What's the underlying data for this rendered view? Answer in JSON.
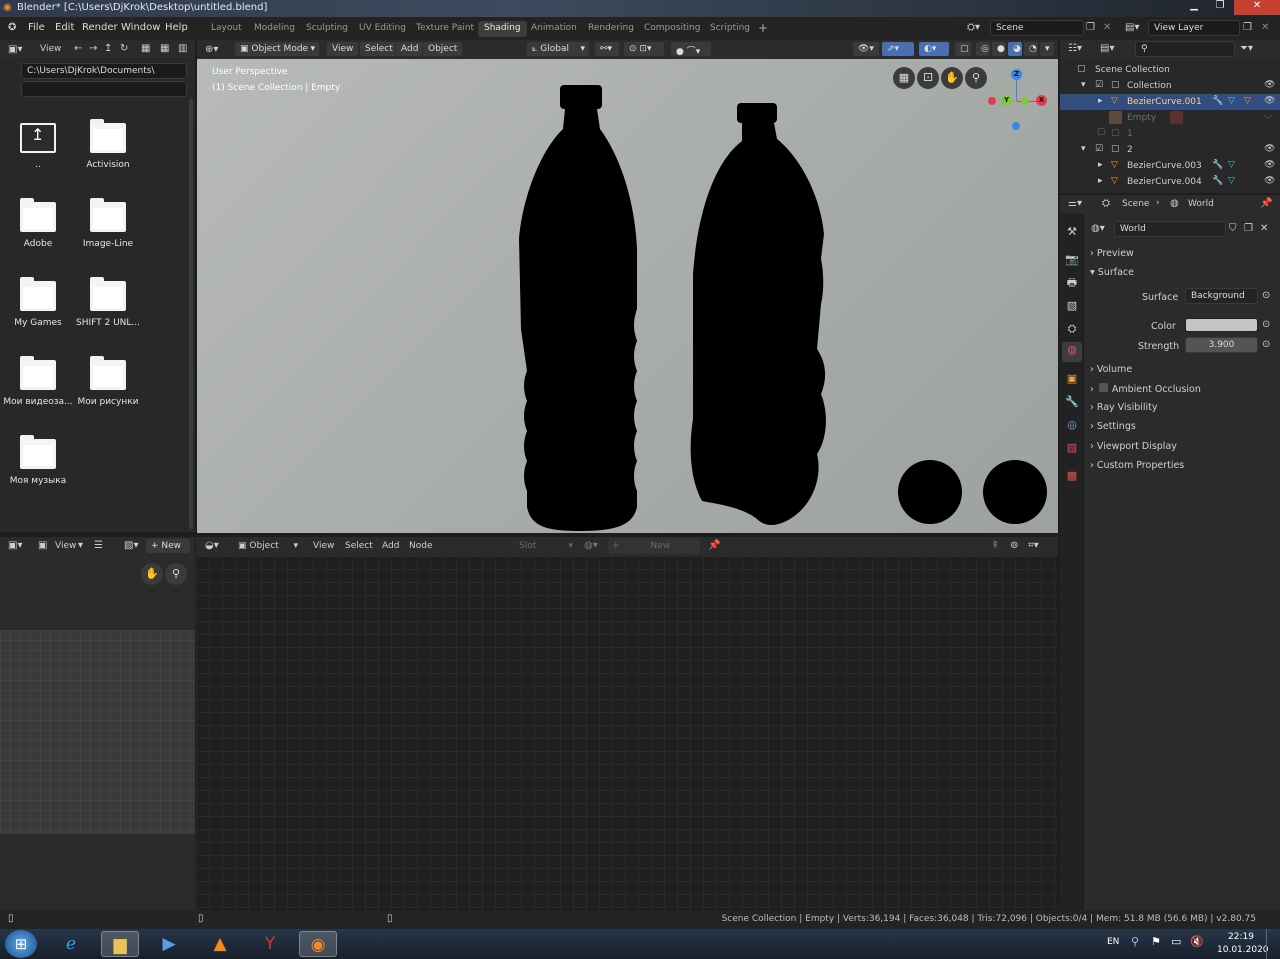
{
  "window": {
    "title": "Blender* [C:\\Users\\DjKrok\\Desktop\\untitled.blend]"
  },
  "menu": {
    "items": [
      "File",
      "Edit",
      "Render",
      "Window",
      "Help"
    ]
  },
  "workspaces": {
    "tabs": [
      "Layout",
      "Modeling",
      "Sculpting",
      "UV Editing",
      "Texture Paint",
      "Shading",
      "Animation",
      "Rendering",
      "Compositing",
      "Scripting"
    ],
    "active": "Shading",
    "add": "+"
  },
  "scene": {
    "name": "Scene",
    "view_layer": "View Layer"
  },
  "file_browser": {
    "view_label": "View",
    "path": "C:\\Users\\DjKrok\\Documents\\",
    "items": [
      "..",
      "Activision",
      "Adobe",
      "Image-Line",
      "My Games",
      "SHIFT 2 UNL...",
      "Мои видеоза...",
      "Мои рисунки",
      "Моя музыка"
    ]
  },
  "viewport": {
    "mode": "Object Mode",
    "menus": [
      "View",
      "Select",
      "Add",
      "Object"
    ],
    "transform": "Global",
    "perspective": "User Perspective",
    "context": "(1) Scene Collection | Empty",
    "gizmo": {
      "z": "Z",
      "y": "Y",
      "x": "X"
    }
  },
  "image_editor": {
    "view_label": "View",
    "new_label": "New"
  },
  "node_editor": {
    "type": "Object",
    "menus": [
      "View",
      "Select",
      "Add",
      "Node"
    ],
    "slot": "Slot",
    "new_label": "New"
  },
  "outliner": {
    "root": "Scene Collection",
    "rows": [
      {
        "name": "Collection"
      },
      {
        "name": "BezierCurve.001"
      },
      {
        "name": "Empty"
      },
      {
        "name": "1"
      },
      {
        "name": "2"
      },
      {
        "name": "BezierCurve.003"
      },
      {
        "name": "BezierCurve.004"
      }
    ]
  },
  "properties": {
    "tabs": [
      "Scene",
      "World"
    ],
    "world_name": "World",
    "panels": {
      "preview": "Preview",
      "surface": "Surface",
      "volume": "Volume",
      "ambient_occlusion": "Ambient Occlusion",
      "ray_visibility": "Ray Visibility",
      "settings": "Settings",
      "viewport_display": "Viewport Display",
      "custom_properties": "Custom Properties"
    },
    "surface_label": "Surface",
    "surface_value": "Background",
    "color_label": "Color",
    "color_value": "#c4c4c4",
    "strength_label": "Strength",
    "strength_value": "3.900"
  },
  "status": {
    "text": "Scene Collection | Empty | Verts:36,194 | Faces:36,048 | Tris:72,096 | Objects:0/4 | Mem: 51.8 MB (56.6 MB) | v2.80.75"
  },
  "taskbar": {
    "lang": "EN",
    "time": "22:19",
    "date": "10.01.2020"
  },
  "colors": {
    "accent": "#334d80",
    "active_tab": "#3d3d3d",
    "x_axis": "#e33c4e",
    "y_axis": "#7ec93a",
    "z_axis": "#3c84e6"
  }
}
